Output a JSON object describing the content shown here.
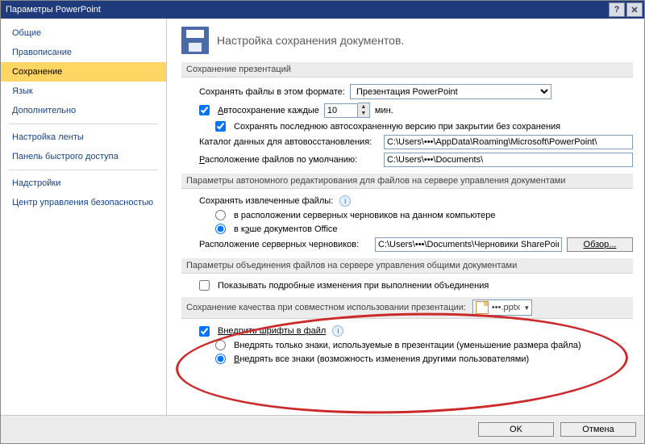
{
  "titlebar": {
    "title": "Параметры PowerPoint"
  },
  "sidebar": {
    "items": [
      "Общие",
      "Правописание",
      "Сохранение",
      "Язык",
      "Дополнительно",
      "Настройка ленты",
      "Панель быстрого доступа",
      "Надстройки",
      "Центр управления безопасностью"
    ],
    "selected_index": 2
  },
  "heading": "Настройка сохранения документов.",
  "sections": {
    "save_pres": {
      "title": "Сохранение презентаций",
      "format_label": "Сохранять файлы в этом формате:",
      "format_value": "Презентация PowerPoint",
      "autosave_label": "Автосохранение каждые",
      "autosave_value": "10",
      "autosave_unit": "мин.",
      "autosave_checked": true,
      "keep_last_label": "Сохранять последнюю автосохраненную версию при закрытии без сохранения",
      "keep_last_checked": true,
      "autorecover_label": "Каталог данных для автовосстановления:",
      "autorecover_value": "C:\\Users\\•••\\AppData\\Roaming\\Microsoft\\PowerPoint\\",
      "default_loc_label": "Расположение файлов по умолчанию:",
      "default_loc_value": "C:\\Users\\•••\\Documents\\"
    },
    "offline": {
      "title": "Параметры автономного редактирования для файлов на сервере управления документами",
      "save_extracted_label": "Сохранять извлеченные файлы:",
      "opt_server_label": "в расположении серверных черновиков на данном компьютере",
      "opt_cache_label": "в кэше документов Office",
      "selected": "cache",
      "drafts_loc_label": "Расположение серверных черновиков:",
      "drafts_loc_value": "C:\\Users\\•••\\Documents\\Черновики SharePoint\\",
      "browse_label": "Обзор..."
    },
    "merge": {
      "title": "Параметры объединения файлов на сервере управления общими документами",
      "detailed_label": "Показывать подробные изменения при выполнении объединения",
      "detailed_checked": false
    },
    "fonts": {
      "title": "Сохранение качества при совместном использовании презентации:",
      "doc_value": "•••.pptx",
      "embed_label": "Внедрить шрифты в файл",
      "embed_checked": true,
      "opt_used_label": "Внедрять только знаки, используемые в презентации (уменьшение размера файла)",
      "opt_all_label": "Внедрять все знаки (возможность изменения другими пользователями)",
      "selected": "all"
    }
  },
  "footer": {
    "ok": "OK",
    "cancel": "Отмена"
  }
}
